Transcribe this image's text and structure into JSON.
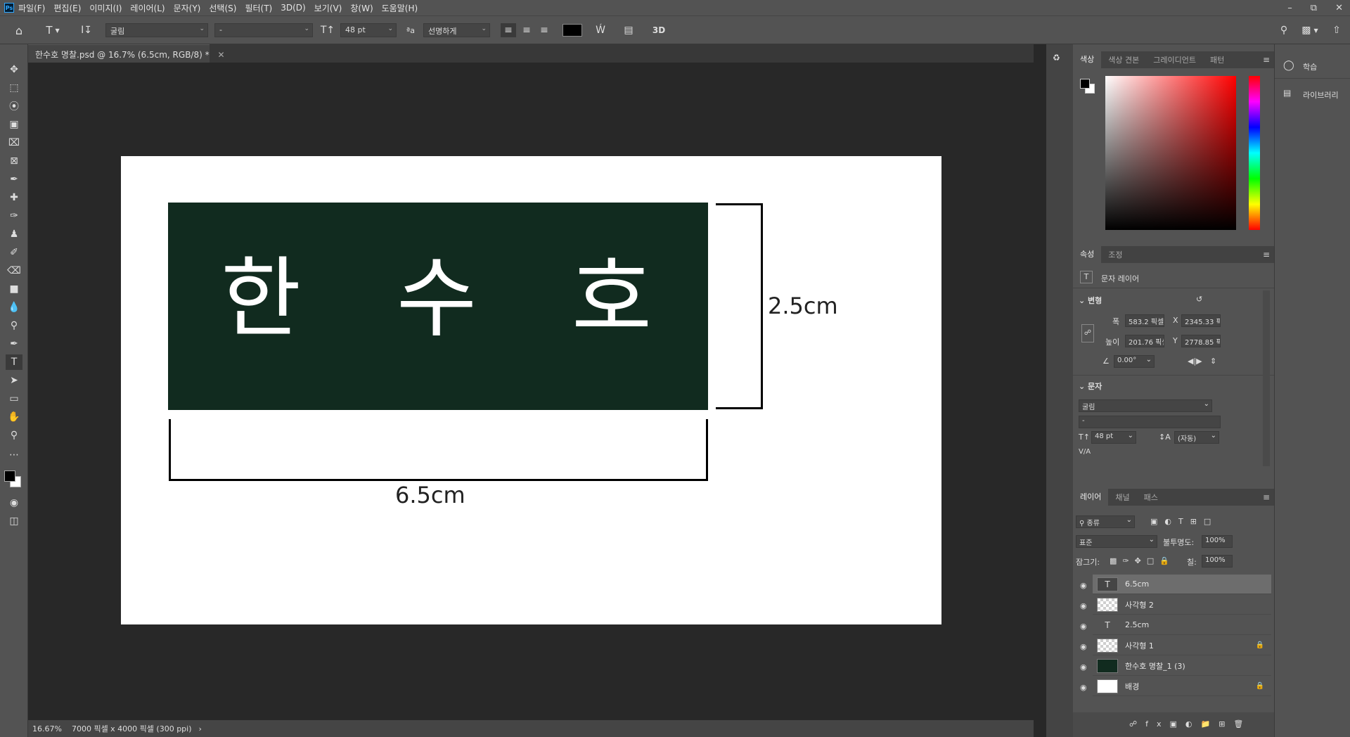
{
  "menubar": {
    "logo": "Ps",
    "items": [
      "파일(F)",
      "편집(E)",
      "이미지(I)",
      "레이어(L)",
      "문자(Y)",
      "선택(S)",
      "필터(T)",
      "3D(D)",
      "보기(V)",
      "창(W)",
      "도움말(H)"
    ]
  },
  "options": {
    "font_family": "굴림",
    "font_style": "-",
    "font_size": "48 pt",
    "antialias_icon": "aa-icon",
    "antialias": "선명하게",
    "three_d": "3D",
    "text_color": "#000000"
  },
  "document": {
    "tab_title": "한수호 명찰.psd @ 16.7% (6.5cm, RGB/8) *",
    "chars": [
      "한",
      "수",
      "호"
    ],
    "height_label": "2.5cm",
    "width_label": "6.5cm",
    "nameplate_color": "#112b1f"
  },
  "status": {
    "zoom": "16.67%",
    "doc_info": "7000 픽셀 x 4000 픽셀 (300 ppi)"
  },
  "color_panel": {
    "tabs": [
      "색상",
      "색상 견본",
      "그레이디언트",
      "패턴"
    ]
  },
  "properties_panel": {
    "tabs": [
      "속성",
      "조정"
    ],
    "layer_kind": "문자 레이어",
    "transform_title": "변형",
    "w_label": "폭",
    "w_value": "583.2 픽셀",
    "x_label": "X",
    "x_value": "2345.33 픽",
    "h_label": "높이",
    "h_value": "201.76 픽셀",
    "y_label": "Y",
    "y_value": "2778.85 픽",
    "angle": "0.00°",
    "char_title": "문자",
    "font_family": "굴림",
    "font_style": "-",
    "font_size": "48 pt",
    "leading": "(자동)",
    "va_label": "V/A"
  },
  "layers_panel": {
    "tabs": [
      "레이어",
      "채널",
      "패스"
    ],
    "filter": "종류",
    "blend_mode": "표준",
    "opacity_label": "불투명도:",
    "opacity": "100%",
    "lock_label": "잠그기:",
    "fill_label": "칠:",
    "fill": "100%",
    "layers": [
      {
        "name": "6.5cm",
        "kind": "text",
        "selected": true,
        "locked": false
      },
      {
        "name": "사각형 2",
        "kind": "shape",
        "selected": false,
        "locked": false
      },
      {
        "name": "2.5cm",
        "kind": "text",
        "selected": false,
        "locked": false
      },
      {
        "name": "사각형 1",
        "kind": "shape",
        "selected": false,
        "locked": true
      },
      {
        "name": "한수호 명찰_1 (3)",
        "kind": "image",
        "selected": false,
        "locked": false
      },
      {
        "name": "배경",
        "kind": "background",
        "selected": false,
        "locked": true
      }
    ]
  },
  "side_panel": {
    "learn": "학습",
    "libraries": "라이브러리"
  }
}
